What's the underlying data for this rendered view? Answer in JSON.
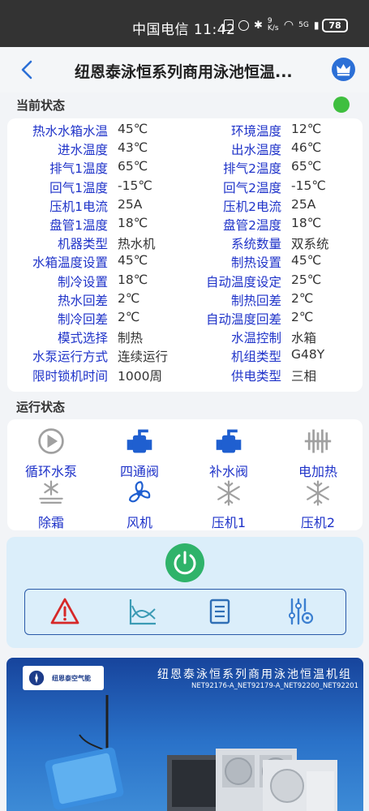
{
  "statusbar": {
    "carrier_time": "中国电信 11:42",
    "network": "9 K/s",
    "signal": "5G",
    "battery": "78"
  },
  "appbar": {
    "title": "纽恩泰泳恒系列商用泳池恒温..."
  },
  "current_status": {
    "title": "当前状态",
    "indicator_color": "#3fbf3f",
    "rows": [
      {
        "l_key": "热水水箱水温",
        "l_val": "45℃",
        "r_key": "环境温度",
        "r_val": "12℃"
      },
      {
        "l_key": "进水温度",
        "l_val": "43℃",
        "r_key": "出水温度",
        "r_val": "46℃"
      },
      {
        "l_key": "排气1温度",
        "l_val": "65℃",
        "r_key": "排气2温度",
        "r_val": "65℃"
      },
      {
        "l_key": "回气1温度",
        "l_val": "-15℃",
        "r_key": "回气2温度",
        "r_val": "-15℃"
      },
      {
        "l_key": "压机1电流",
        "l_val": "25A",
        "r_key": "压机2电流",
        "r_val": "25A"
      },
      {
        "l_key": "盘管1温度",
        "l_val": "18℃",
        "r_key": "盘管2温度",
        "r_val": "18℃"
      },
      {
        "l_key": "机器类型",
        "l_val": "热水机",
        "r_key": "系统数量",
        "r_val": "双系统"
      },
      {
        "l_key": "水箱温度设置",
        "l_val": "45℃",
        "r_key": "制热设置",
        "r_val": "45℃"
      },
      {
        "l_key": "制冷设置",
        "l_val": "18℃",
        "r_key": "自动温度设定",
        "r_val": "25℃"
      },
      {
        "l_key": "热水回差",
        "l_val": "2℃",
        "r_key": "制热回差",
        "r_val": "2℃"
      },
      {
        "l_key": "制冷回差",
        "l_val": "2℃",
        "r_key": "自动温度回差",
        "r_val": "2℃"
      },
      {
        "l_key": "模式选择",
        "l_val": "制热",
        "r_key": "水温控制",
        "r_val": "水箱"
      },
      {
        "l_key": "水泵运行方式",
        "l_val": "连续运行",
        "r_key": "机组类型",
        "r_val": "G48Y"
      },
      {
        "l_key": "限时锁机时间",
        "l_val": "1000周",
        "r_key": "供电类型",
        "r_val": "三相"
      }
    ]
  },
  "run_status": {
    "title": "运行状态",
    "items": [
      {
        "label": "循环水泵",
        "icon": "pump-icon",
        "state_color": "#a0a0a0"
      },
      {
        "label": "四通阀",
        "icon": "four-way-valve-icon",
        "state_color": "#1f5fd0"
      },
      {
        "label": "补水阀",
        "icon": "refill-valve-icon",
        "state_color": "#1f5fd0"
      },
      {
        "label": "电加热",
        "icon": "electric-heater-icon",
        "state_color": "#a0a0a0"
      },
      {
        "label": "除霜",
        "icon": "defrost-icon",
        "state_color": "#a0a0a0"
      },
      {
        "label": "风机",
        "icon": "fan-icon",
        "state_color": "#1f5fd0"
      },
      {
        "label": "压机1",
        "icon": "compressor-1-icon",
        "state_color": "#a0a0a0"
      },
      {
        "label": "压机2",
        "icon": "compressor-2-icon",
        "state_color": "#a0a0a0"
      }
    ]
  },
  "banner": {
    "logo_text": "纽恩泰空气能",
    "heading": "纽恩泰泳恒系列商用泳池恒温机组",
    "models": "NET92176-A_NET92179-A_NET92200_NET92201"
  }
}
